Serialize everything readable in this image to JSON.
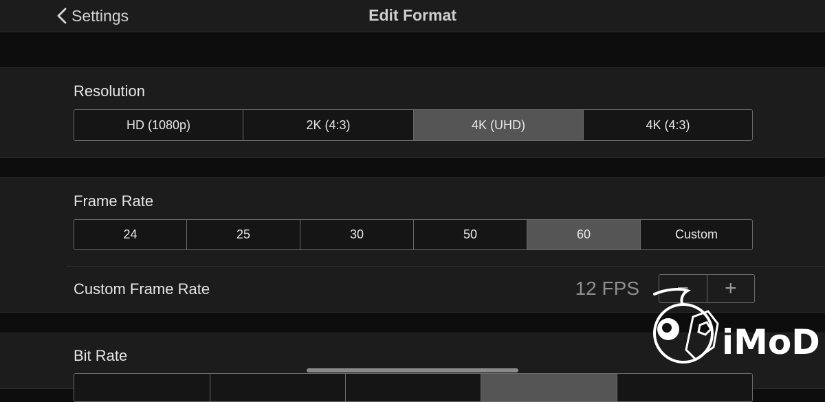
{
  "nav": {
    "back_label": "Settings",
    "title": "Edit Format"
  },
  "resolution": {
    "label": "Resolution",
    "options": [
      "HD (1080p)",
      "2K (4:3)",
      "4K (UHD)",
      "4K (4:3)"
    ],
    "selected": "4K (UHD)"
  },
  "frame_rate": {
    "label": "Frame Rate",
    "options": [
      "24",
      "25",
      "30",
      "50",
      "60",
      "Custom"
    ],
    "selected": "60"
  },
  "custom_frame_rate": {
    "label": "Custom Frame Rate",
    "value": "12 FPS",
    "decrement": "−",
    "increment": "+"
  },
  "bit_rate": {
    "label": "Bit Rate"
  },
  "watermark": {
    "text": "iMoD"
  },
  "colors": {
    "background": "#0d0d0d",
    "group": "#1c1c1c",
    "selected": "#555555",
    "border": "#6a6a6a"
  }
}
